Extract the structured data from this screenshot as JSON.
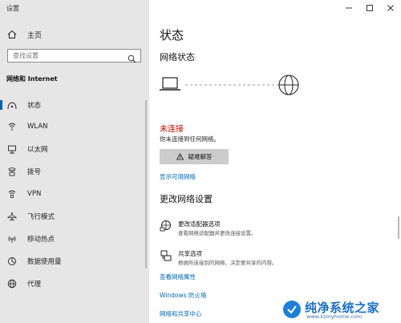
{
  "window": {
    "title": "设置"
  },
  "sidebar": {
    "home_label": "主页",
    "search_placeholder": "查找设置",
    "section_title": "网络和 Internet",
    "items": [
      {
        "label": "状态",
        "icon": "home-status-icon",
        "active": true
      },
      {
        "label": "WLAN",
        "icon": "wifi-icon"
      },
      {
        "label": "以太网",
        "icon": "ethernet-icon"
      },
      {
        "label": "拨号",
        "icon": "dialup-icon"
      },
      {
        "label": "VPN",
        "icon": "vpn-icon"
      },
      {
        "label": "飞行模式",
        "icon": "airplane-icon"
      },
      {
        "label": "移动热点",
        "icon": "hotspot-icon"
      },
      {
        "label": "数据使用量",
        "icon": "data-usage-icon"
      },
      {
        "label": "代理",
        "icon": "globe-icon"
      }
    ]
  },
  "main": {
    "title": "状态",
    "network_status_heading": "网络状态",
    "status_text": "未连接",
    "status_desc": "你未连接到任何网络。",
    "troubleshoot_label": "疑难解答",
    "show_networks_link": "显示可用网络",
    "change_settings_heading": "更改网络设置",
    "options": [
      {
        "title": "更改适配器选项",
        "desc": "查看网络适配器并更改连接设置。",
        "icon": "adapter-icon"
      },
      {
        "title": "共享选项",
        "desc": "根据所连接到的网络，决定要共享的内容。",
        "icon": "sharing-icon"
      }
    ],
    "links": [
      "查看网络属性",
      "Windows 防火墙",
      "网络和共享中心"
    ]
  },
  "watermark": {
    "text": "纯净系统之家",
    "url": "www.kzmyhome.com"
  },
  "colors": {
    "accent": "#0063b1",
    "link": "#0066b4",
    "error": "#c50500",
    "sidebar_bg": "#e6e6e6"
  }
}
